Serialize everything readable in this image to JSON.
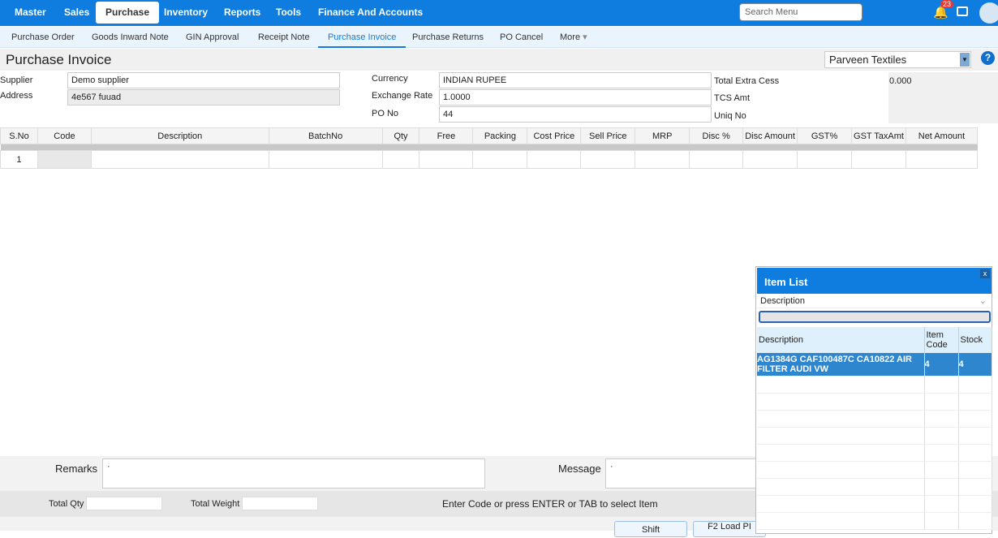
{
  "nav": {
    "items": [
      "Master",
      "Sales",
      "Purchase",
      "Inventory",
      "Reports",
      "Tools",
      "Finance And Accounts"
    ],
    "active": "Purchase",
    "search_placeholder": "Search Menu",
    "notification_count": "23"
  },
  "subnav": {
    "items": [
      "Purchase Order",
      "Goods Inward Note",
      "GIN Approval",
      "Receipt Note",
      "Purchase Invoice",
      "Purchase Returns",
      "PO Cancel",
      "More"
    ],
    "active": "Purchase Invoice"
  },
  "page": {
    "title": "Purchase Invoice",
    "company": "Parveen Textiles",
    "help": "?"
  },
  "form": {
    "supplier_label": "Supplier",
    "supplier": "Demo supplier",
    "address_label": "Address",
    "address": "4e567 fuuad",
    "currency_label": "Currency",
    "currency": "INDIAN RUPEE",
    "exchange_rate_label": "Exchange Rate",
    "exchange_rate": "1.0000",
    "po_no_label": "PO No",
    "po_no": "44",
    "extra_cess_label": "Total Extra Cess",
    "extra_cess": "0.000",
    "tcs_label": "TCS Amt",
    "uniq_label": "Uniq No"
  },
  "grid": {
    "columns": [
      "S.No",
      "Code",
      "Description",
      "BatchNo",
      "Qty",
      "Free",
      "Packing",
      "Cost Price",
      "Sell Price",
      "MRP",
      "Disc %",
      "Disc Amount",
      "GST%",
      "GST TaxAmt",
      "Net Amount"
    ],
    "rows": [
      [
        "1",
        "",
        "",
        "",
        "",
        "",
        "",
        "",
        "",
        "",
        "",
        "",
        "",
        "",
        ""
      ]
    ]
  },
  "footer": {
    "remarks_label": "Remarks",
    "remarks": "·",
    "message_label": "Message",
    "message": "·",
    "total_qty_label": "Total Qty",
    "total_weight_label": "Total Weight",
    "hint": "Enter Code or press ENTER or TAB to select Item",
    "buttons": [
      "Shift",
      "F2 Load PI"
    ]
  },
  "item_list": {
    "title": "Item List",
    "close": "x",
    "search_by": "Description",
    "columns": [
      "Description",
      "Item Code",
      "Stock"
    ],
    "rows": [
      {
        "description": "AG1384G CAF100487C CA10822 AIR FILTER AUDI VW",
        "code": "4",
        "stock": "4"
      }
    ]
  }
}
